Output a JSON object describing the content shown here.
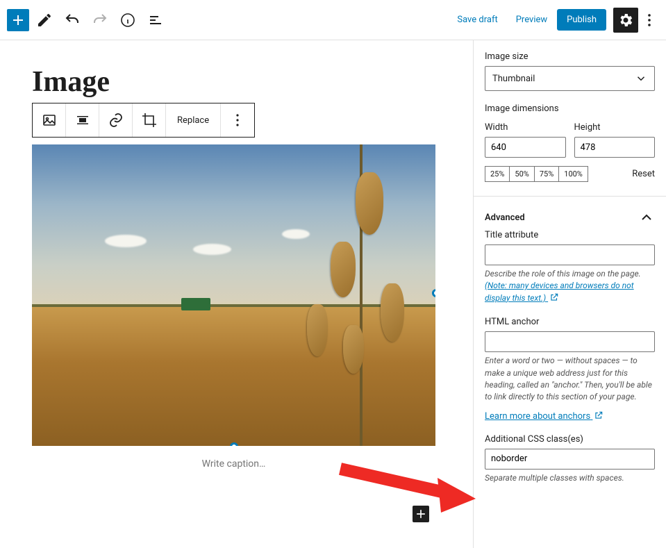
{
  "toolbar": {
    "save_draft": "Save draft",
    "preview": "Preview",
    "publish": "Publish"
  },
  "editor": {
    "page_title": "Image",
    "block_toolbar": {
      "replace": "Replace"
    },
    "caption_placeholder": "Write caption…"
  },
  "sidebar": {
    "image_size": {
      "label": "Image size",
      "value": "Thumbnail"
    },
    "image_dimensions": {
      "label": "Image dimensions",
      "width_label": "Width",
      "width_value": "640",
      "height_label": "Height",
      "height_value": "478",
      "pct_25": "25%",
      "pct_50": "50%",
      "pct_75": "75%",
      "pct_100": "100%",
      "reset": "Reset"
    },
    "advanced": {
      "title": "Advanced",
      "title_attribute": {
        "label": "Title attribute",
        "value": "",
        "help_prefix": "Describe the role of this image on the page.",
        "help_link": "(Note: many devices and browsers do not display this text.)"
      },
      "html_anchor": {
        "label": "HTML anchor",
        "value": "",
        "help": "Enter a word or two — without spaces — to make a unique web address just for this heading, called an \"anchor.\" Then, you'll be able to link directly to this section of your page.",
        "learn_more": "Learn more about anchors"
      },
      "css_classes": {
        "label": "Additional CSS class(es)",
        "value": "noborder",
        "help": "Separate multiple classes with spaces."
      }
    }
  }
}
